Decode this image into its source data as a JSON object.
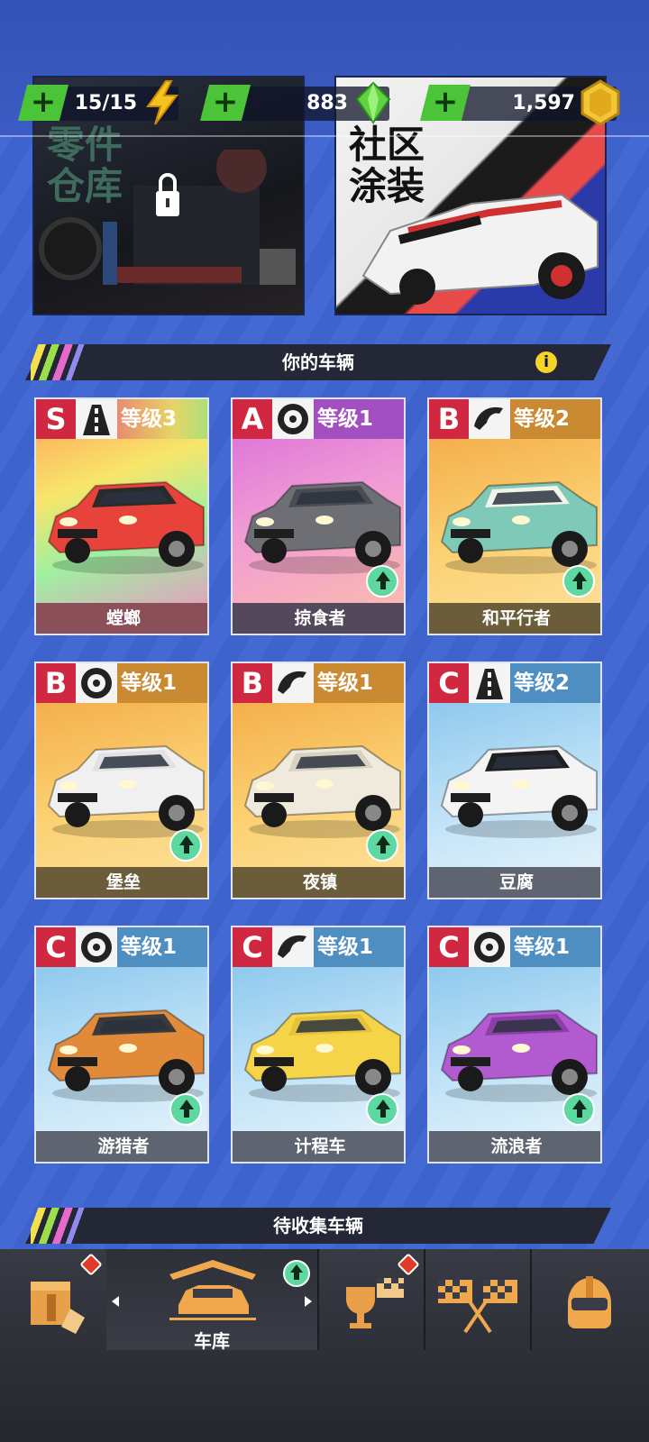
{
  "resources": {
    "energy": {
      "value": "15/15",
      "icon": "lightning-icon"
    },
    "gems": {
      "value": "883",
      "icon": "gem-icon"
    },
    "coins": {
      "value": "1,597",
      "icon": "coin-icon"
    }
  },
  "panels": {
    "parts_warehouse": {
      "title_line1": "零件",
      "title_line2": "仓库"
    },
    "community_paint": {
      "title_line1": "社区",
      "title_line2": "涂装"
    }
  },
  "sections": {
    "your_vehicles": "你的车辆",
    "to_collect": "待收集车辆"
  },
  "cars": [
    {
      "grade": "S",
      "class_icon": "road-icon",
      "level": "等级3",
      "name": "螳螂",
      "upgrade": false,
      "body": "#e8433a",
      "roof": "#2a2a2a"
    },
    {
      "grade": "A",
      "class_icon": "tire-icon",
      "level": "等级1",
      "name": "掠食者",
      "upgrade": true,
      "body": "#6d6f75",
      "roof": "#4a4c52"
    },
    {
      "grade": "B",
      "class_icon": "horse-icon",
      "level": "等级2",
      "name": "和平行者",
      "upgrade": true,
      "body": "#7fc9b8",
      "roof": "#f3f3ea"
    },
    {
      "grade": "B",
      "class_icon": "tire-icon",
      "level": "等级1",
      "name": "堡垒",
      "upgrade": true,
      "body": "#f0f0f0",
      "roof": "#e2e2e2"
    },
    {
      "grade": "B",
      "class_icon": "horse-icon",
      "level": "等级1",
      "name": "夜镇",
      "upgrade": true,
      "body": "#efeadc",
      "roof": "#d8d2c0"
    },
    {
      "grade": "C",
      "class_icon": "road-icon",
      "level": "等级2",
      "name": "豆腐",
      "upgrade": false,
      "body": "#f4f4f4",
      "roof": "#1f1f1f"
    },
    {
      "grade": "C",
      "class_icon": "tire-icon",
      "level": "等级1",
      "name": "游猎者",
      "upgrade": true,
      "body": "#e08a3a",
      "roof": "#3a3a3a"
    },
    {
      "grade": "C",
      "class_icon": "horse-icon",
      "level": "等级1",
      "name": "计程车",
      "upgrade": true,
      "body": "#f5d44a",
      "roof": "#e5c23a"
    },
    {
      "grade": "C",
      "class_icon": "tire-icon",
      "level": "等级1",
      "name": "流浪者",
      "upgrade": true,
      "body": "#b25ad0",
      "roof": "#8a40a8"
    }
  ],
  "nav": {
    "garage_label": "车库"
  },
  "colors": {
    "accent_green": "#4bc43a",
    "grade_red": "#d02840"
  }
}
